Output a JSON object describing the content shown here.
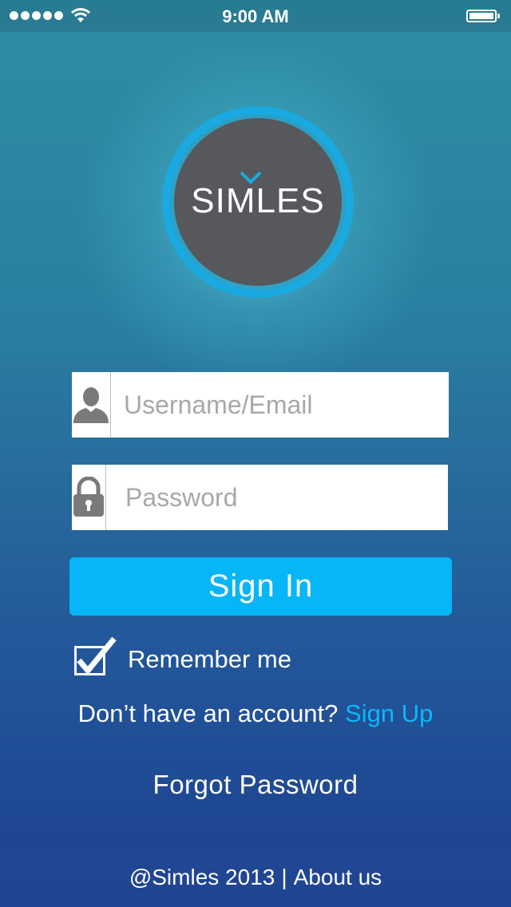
{
  "status_bar": {
    "time": "9:00 AM",
    "signal_icon": "signal-dots-icon",
    "wifi_icon": "wifi-icon",
    "battery_icon": "battery-icon"
  },
  "logo": {
    "text": "SIMLES"
  },
  "form": {
    "username": {
      "placeholder": "Username/Email",
      "value": "",
      "icon": "user-icon"
    },
    "password": {
      "placeholder": "Password",
      "value": "",
      "icon": "lock-icon"
    },
    "signin_label": "Sign In",
    "remember_label": "Remember me",
    "remember_checked": true,
    "signup_prompt": "Don’t have an account?",
    "signup_link": "Sign Up",
    "forgot_label": "Forgot Password"
  },
  "footer": {
    "copyright": "@Simles 2013",
    "separator": "|",
    "about_label": "About us"
  },
  "colors": {
    "accent": "#06b6f7",
    "logo_fill": "#56585b",
    "logo_ring": "#1aa9e0"
  }
}
